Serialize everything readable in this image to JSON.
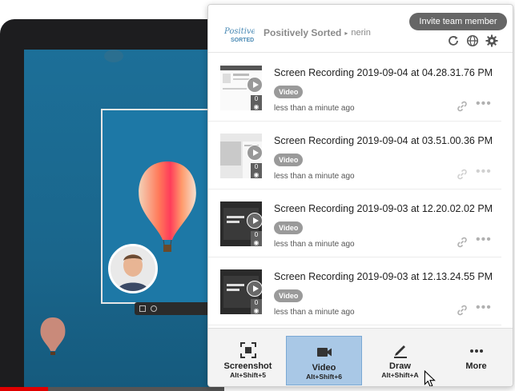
{
  "popup": {
    "brand": {
      "org": "Positively Sorted",
      "user": "nerin",
      "logo_text": "Positively SORTED"
    },
    "invite_label": "Invite team member",
    "header_icons": [
      "refresh-icon",
      "globe-icon",
      "gear-icon"
    ]
  },
  "recordings": [
    {
      "title": "Screen Recording 2019-09-04 at 04.28.31.76 PM",
      "badge": "Video",
      "time": "less than a minute ago",
      "views": "0"
    },
    {
      "title": "Screen Recording 2019-09-04 at 03.51.00.36 PM",
      "badge": "Video",
      "time": "less than a minute ago",
      "views": "0"
    },
    {
      "title": "Screen Recording 2019-09-03 at 12.20.02.02 PM",
      "badge": "Video",
      "time": "less than a minute ago",
      "views": "0"
    },
    {
      "title": "Screen Recording 2019-09-03 at 12.13.24.55 PM",
      "badge": "Video",
      "time": "less than a minute ago",
      "views": "0"
    }
  ],
  "tools": [
    {
      "label": "Screenshot",
      "shortcut": "Alt+Shift+5",
      "icon": "screenshot-icon"
    },
    {
      "label": "Video",
      "shortcut": "Alt+Shift+6",
      "icon": "video-camera-icon",
      "active": true
    },
    {
      "label": "Draw",
      "shortcut": "Alt+Shift+A",
      "icon": "pencil-icon"
    },
    {
      "label": "More",
      "shortcut": "",
      "icon": "more-icon"
    }
  ],
  "colors": {
    "accent_active": "#a9c8e6",
    "invite_bg": "#666666",
    "badge_bg": "#9a9a9a",
    "screen_bg": "#1a6e97",
    "progress": "#e00000"
  }
}
